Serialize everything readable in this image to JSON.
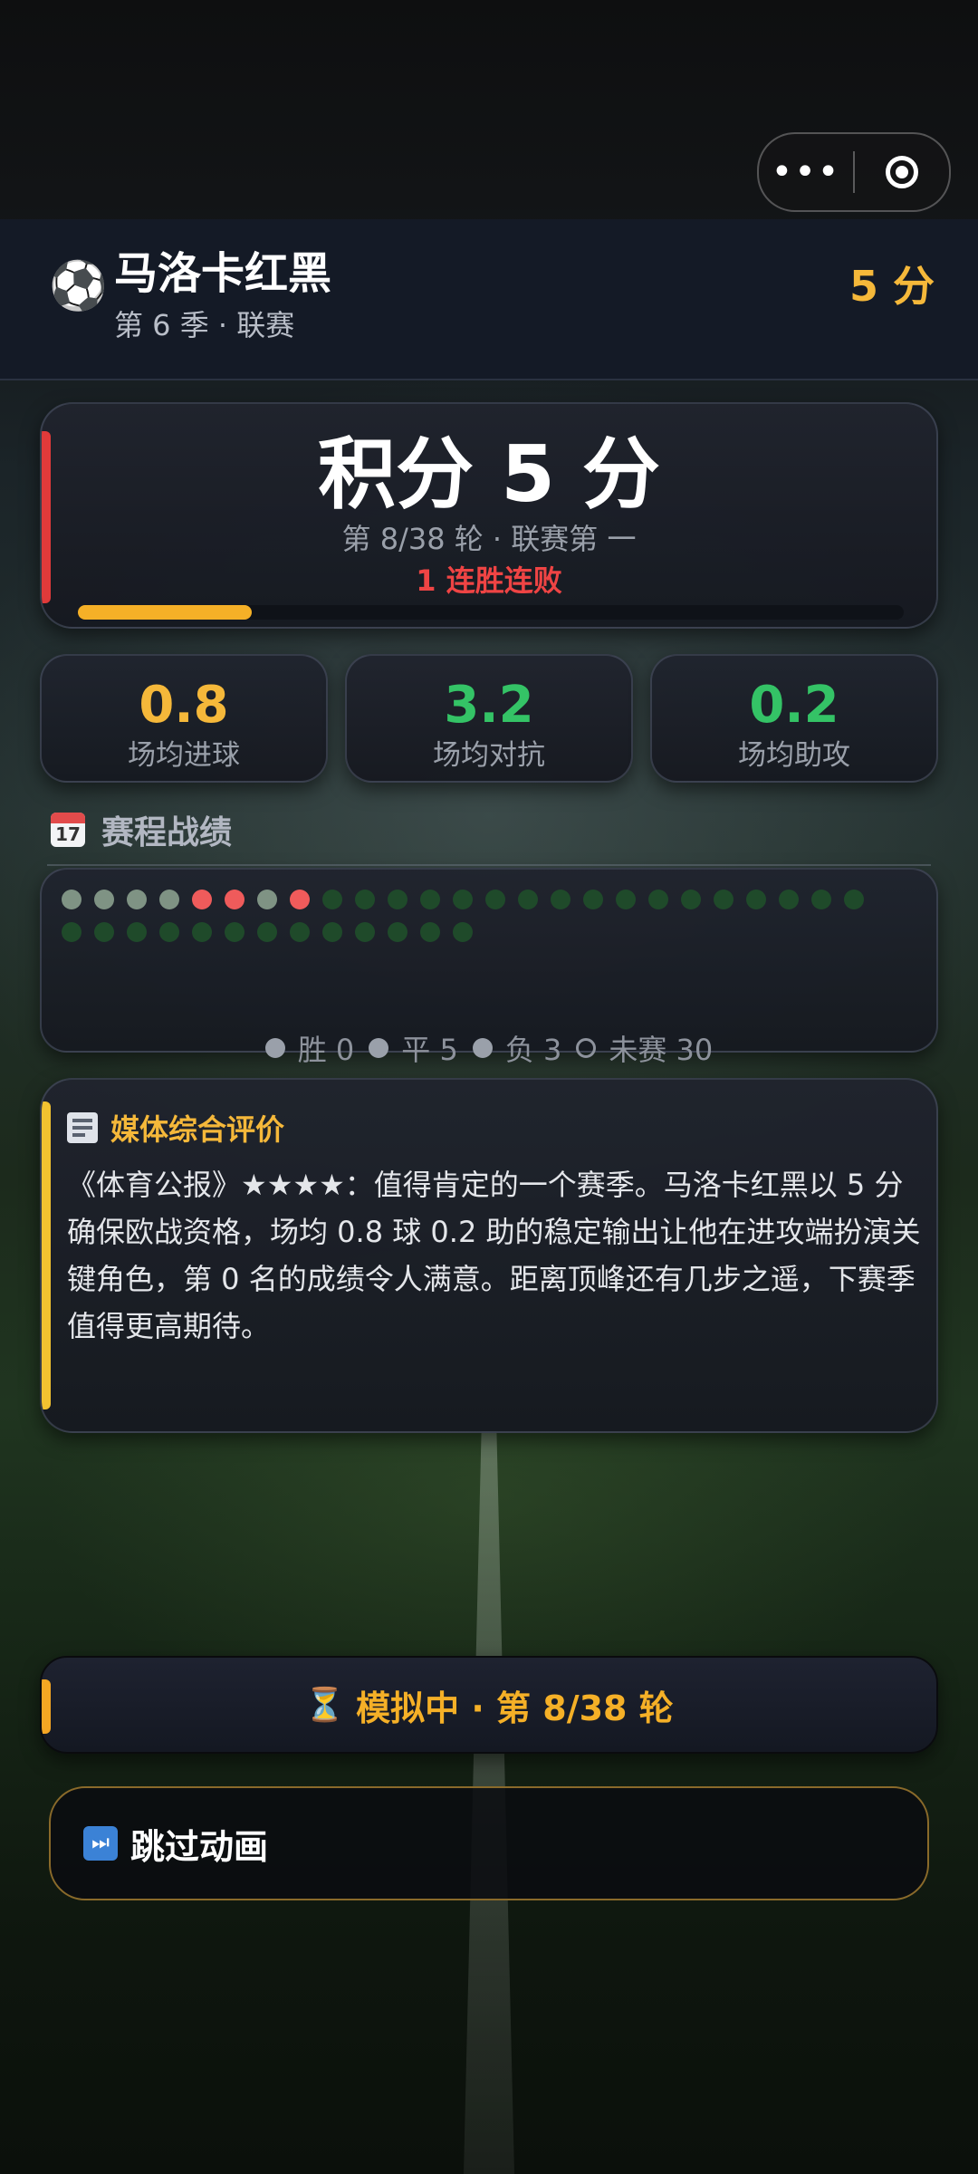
{
  "header": {
    "team_name": "马洛卡红黑",
    "season_info": "第 6 季 · 联赛",
    "points": "5 分",
    "icon": "soccer-ball-icon"
  },
  "mini_program_capsule": {
    "more_label": "•••",
    "icons": [
      "more-icon",
      "close-target-icon"
    ]
  },
  "score_card": {
    "title": "积分 5 分",
    "subtitle": "第 8/38 轮 · 联赛第 一",
    "streak": "1 连胜连败",
    "progress": 0.21,
    "progress_color": "#f5b027",
    "accent_color": "#e03a3a"
  },
  "stats": [
    {
      "value": "0.8",
      "label": "场均进球",
      "color": "#f5b83a"
    },
    {
      "value": "3.2",
      "label": "场均对抗",
      "color": "#34c366"
    },
    {
      "value": "0.2",
      "label": "场均助攻",
      "color": "#34c366"
    }
  ],
  "schedule": {
    "title": "赛程战绩",
    "icon": "calendar-icon",
    "calendar_day": "17",
    "results": [
      "draw",
      "draw",
      "draw",
      "draw",
      "loss",
      "loss",
      "draw",
      "loss",
      "pending",
      "pending",
      "pending",
      "pending",
      "pending",
      "pending",
      "pending",
      "pending",
      "pending",
      "pending",
      "pending",
      "pending",
      "pending",
      "pending",
      "pending",
      "pending",
      "pending",
      "pending",
      "pending",
      "pending",
      "pending",
      "pending",
      "pending",
      "pending",
      "pending",
      "pending",
      "pending",
      "pending",
      "pending",
      "pending"
    ],
    "colors": {
      "win": "#2f9e5a",
      "draw": "#7f9384",
      "loss": "#ef5b5b",
      "pending": "#1f4a2a"
    },
    "legend": [
      {
        "label": "胜 0",
        "swatch": "#9aa0aa",
        "hollow": false
      },
      {
        "label": "平 5",
        "swatch": "#9aa0aa",
        "hollow": false
      },
      {
        "label": "负 3",
        "swatch": "#9aa0aa",
        "hollow": false
      },
      {
        "label": "未赛 30",
        "swatch": "#8d929c",
        "hollow": true
      }
    ]
  },
  "review": {
    "title": "媒体综合评价",
    "icon": "newspaper-icon",
    "body": "《体育公报》★★★★：值得肯定的一个赛季。马洛卡红黑以 5 分确保欧战资格，场均 0.8 球 0.2 助的稳定输出让他在进攻端扮演关键角色，第 0 名的成绩令人满意。距离顶峰还有几步之遥，下赛季值得更高期待。",
    "accent_color": "#f2c230"
  },
  "simulation": {
    "icon": "hourglass-icon",
    "text": "模拟中 · 第 8/38 轮"
  },
  "skip_button": {
    "icon": "fast-forward-icon",
    "label": "跳过动画"
  }
}
